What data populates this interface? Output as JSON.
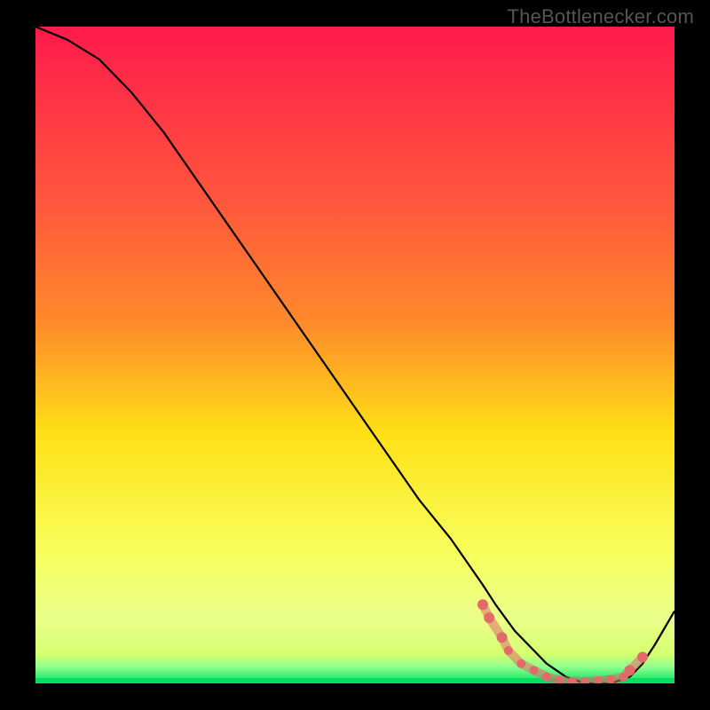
{
  "watermark": "TheBottlenecker.com",
  "chart_data": {
    "type": "line",
    "title": "",
    "xlabel": "",
    "ylabel": "",
    "xlim": [
      0,
      100
    ],
    "ylim": [
      0,
      100
    ],
    "background_gradient": {
      "top": "#ff1a4b",
      "upper_mid": "#ff8a2a",
      "mid": "#ffe016",
      "lower_mid": "#f7ff5c",
      "low_band": "#d6ff70",
      "bottom": "#00e060"
    },
    "series": [
      {
        "name": "bottleneck-curve",
        "x": [
          0,
          5,
          10,
          15,
          20,
          25,
          30,
          35,
          40,
          45,
          50,
          55,
          60,
          65,
          70,
          72,
          75,
          78,
          80,
          83,
          86,
          90,
          93,
          95,
          97,
          100
        ],
        "y": [
          100,
          98,
          95,
          90,
          84,
          77,
          70,
          63,
          56,
          49,
          42,
          35,
          28,
          22,
          15,
          12,
          8,
          5,
          3,
          1,
          0,
          0,
          1,
          3,
          6,
          11
        ]
      }
    ],
    "scatter_points": {
      "name": "highlight-dots",
      "color": "#e26a6a",
      "x": [
        70,
        71,
        73,
        74,
        76,
        78,
        80,
        82,
        84,
        86,
        88,
        90,
        92,
        93,
        95
      ],
      "y": [
        12,
        10,
        7,
        5,
        3,
        2,
        1,
        0.5,
        0.3,
        0.3,
        0.4,
        0.6,
        1,
        2,
        4
      ]
    }
  }
}
